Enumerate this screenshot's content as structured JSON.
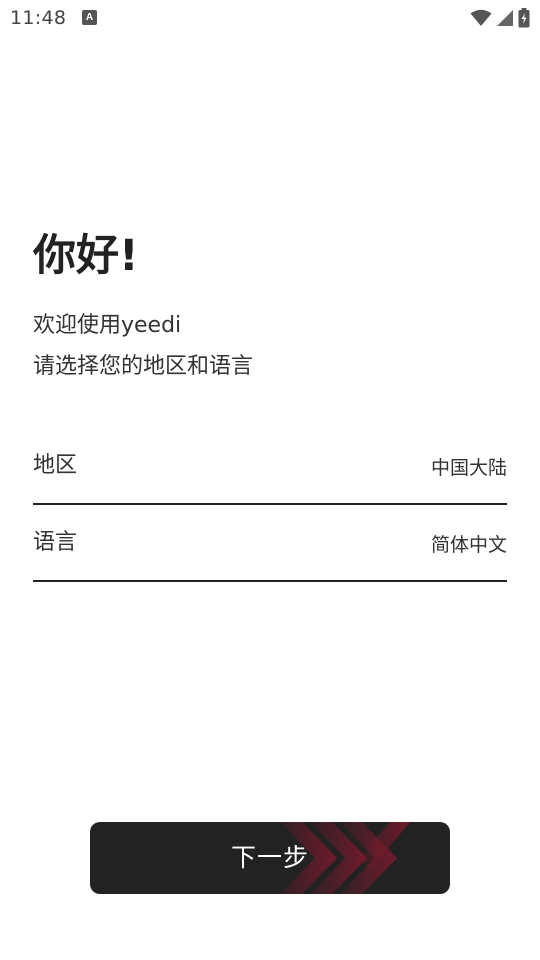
{
  "status_bar": {
    "time": "11:48",
    "notification_icon_text": "A",
    "icons": [
      "wifi-icon",
      "cellular-signal-icon",
      "battery-charging-icon"
    ]
  },
  "greeting": {
    "title": "你好!",
    "line1": "欢迎使用yeedi",
    "line2": "请选择您的地区和语言"
  },
  "settings": {
    "region": {
      "label": "地区",
      "value": "中国大陆"
    },
    "language": {
      "label": "语言",
      "value": "简体中文"
    }
  },
  "next_button": {
    "label": "下一步",
    "accent_color": "#7a1a2c"
  }
}
